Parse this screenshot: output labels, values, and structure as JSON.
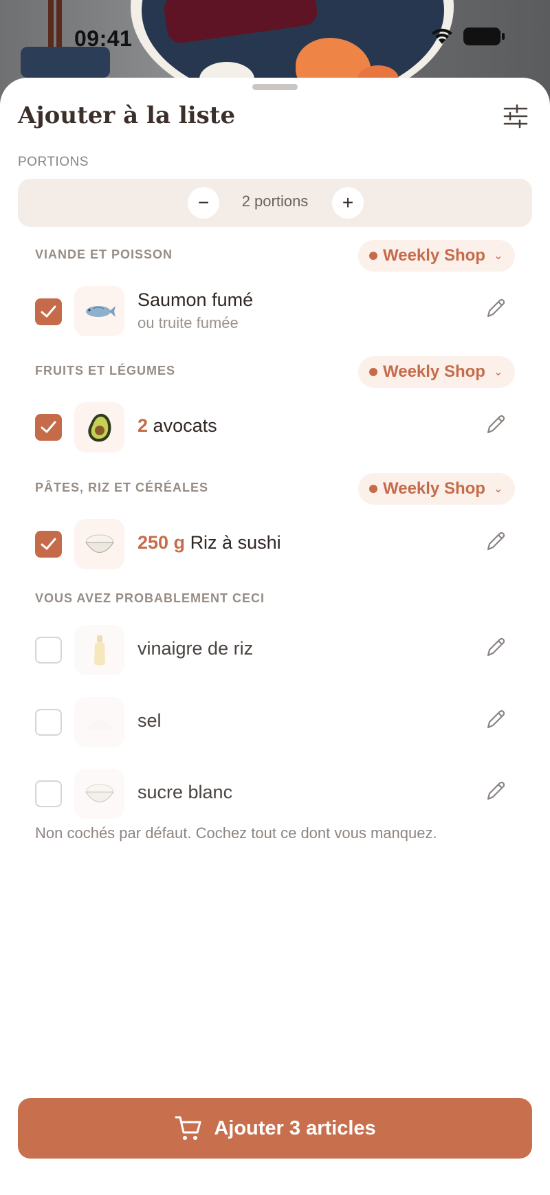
{
  "status_bar": {
    "time": "09:41"
  },
  "sheet": {
    "title": "Ajouter à la liste",
    "portions": {
      "label": "PORTIONS",
      "value": "2 portions",
      "minus": "−",
      "plus": "+"
    }
  },
  "sections": [
    {
      "title": "VIANDE ET POISSON",
      "store": "Weekly Shop",
      "items": [
        {
          "qty": "",
          "name": "Saumon fumé",
          "sub": "ou truite fumée",
          "checked": true,
          "icon": "fish-icon"
        }
      ]
    },
    {
      "title": "FRUITS ET LÉGUMES",
      "store": "Weekly Shop",
      "items": [
        {
          "qty": "2",
          "name": "avocats",
          "sub": "",
          "checked": true,
          "icon": "avocado-icon"
        }
      ]
    },
    {
      "title": "PÂTES, RIZ ET CÉRÉALES",
      "store": "Weekly Shop",
      "items": [
        {
          "qty": "250 g",
          "name": "Riz à sushi",
          "sub": "",
          "checked": true,
          "icon": "rice-bowl-icon"
        }
      ]
    },
    {
      "title": "VOUS AVEZ PROBABLEMENT CECI",
      "items": [
        {
          "name": "vinaigre de riz",
          "checked": false,
          "icon": "bottle-icon"
        },
        {
          "name": "sel",
          "checked": false,
          "icon": "salt-icon"
        },
        {
          "name": "sucre blanc",
          "checked": false,
          "icon": "sugar-bowl-icon"
        }
      ]
    }
  ],
  "footnote": "Non cochés par défaut. Cochez tout ce dont vous manquez.",
  "cta": {
    "label": "Ajouter 3 articles",
    "icon": "cart-icon"
  },
  "colors": {
    "accent": "#c66b4a",
    "cta": "#c8704d",
    "pill_bg": "#fbf0ea",
    "portions_bg": "#f4ece6"
  }
}
